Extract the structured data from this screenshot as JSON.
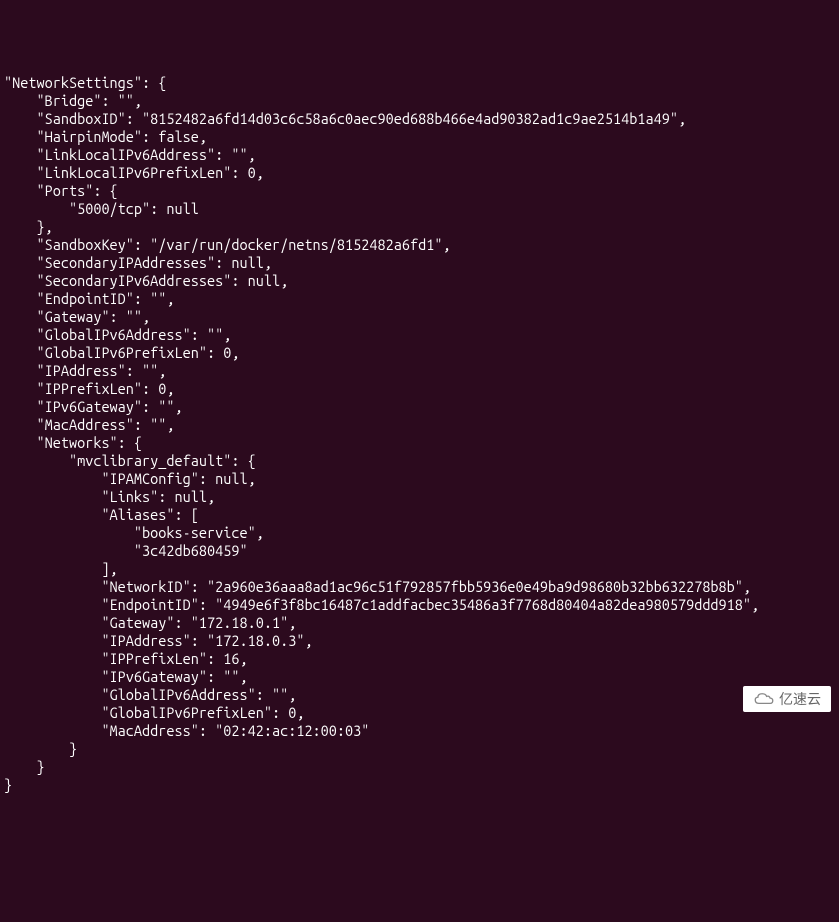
{
  "terminal": {
    "lines": [
      "\"NetworkSettings\": {",
      "    \"Bridge\": \"\",",
      "    \"SandboxID\": \"8152482a6fd14d03c6c58a6c0aec90ed688b466e4ad90382ad1c9ae2514b1a49\",",
      "    \"HairpinMode\": false,",
      "    \"LinkLocalIPv6Address\": \"\",",
      "    \"LinkLocalIPv6PrefixLen\": 0,",
      "    \"Ports\": {",
      "        \"5000/tcp\": null",
      "    },",
      "    \"SandboxKey\": \"/var/run/docker/netns/8152482a6fd1\",",
      "    \"SecondaryIPAddresses\": null,",
      "    \"SecondaryIPv6Addresses\": null,",
      "    \"EndpointID\": \"\",",
      "    \"Gateway\": \"\",",
      "    \"GlobalIPv6Address\": \"\",",
      "    \"GlobalIPv6PrefixLen\": 0,",
      "    \"IPAddress\": \"\",",
      "    \"IPPrefixLen\": 0,",
      "    \"IPv6Gateway\": \"\",",
      "    \"MacAddress\": \"\",",
      "    \"Networks\": {",
      "        \"mvclibrary_default\": {",
      "            \"IPAMConfig\": null,",
      "            \"Links\": null,",
      "            \"Aliases\": [",
      "                \"books-service\",",
      "                \"3c42db680459\"",
      "            ],",
      "            \"NetworkID\": \"2a960e36aaa8ad1ac96c51f792857fbb5936e0e49ba9d98680b32bb632278b8b\",",
      "            \"EndpointID\": \"4949e6f3f8bc16487c1addfacbec35486a3f7768d80404a82dea980579ddd918\",",
      "            \"Gateway\": \"172.18.0.1\",",
      "            \"IPAddress\": \"172.18.0.3\",",
      "            \"IPPrefixLen\": 16,",
      "            \"IPv6Gateway\": \"\",",
      "            \"GlobalIPv6Address\": \"\",",
      "            \"GlobalIPv6PrefixLen\": 0,",
      "            \"MacAddress\": \"02:42:ac:12:00:03\"",
      "        }",
      "    }",
      "}"
    ]
  },
  "watermark": {
    "text": "亿速云"
  }
}
